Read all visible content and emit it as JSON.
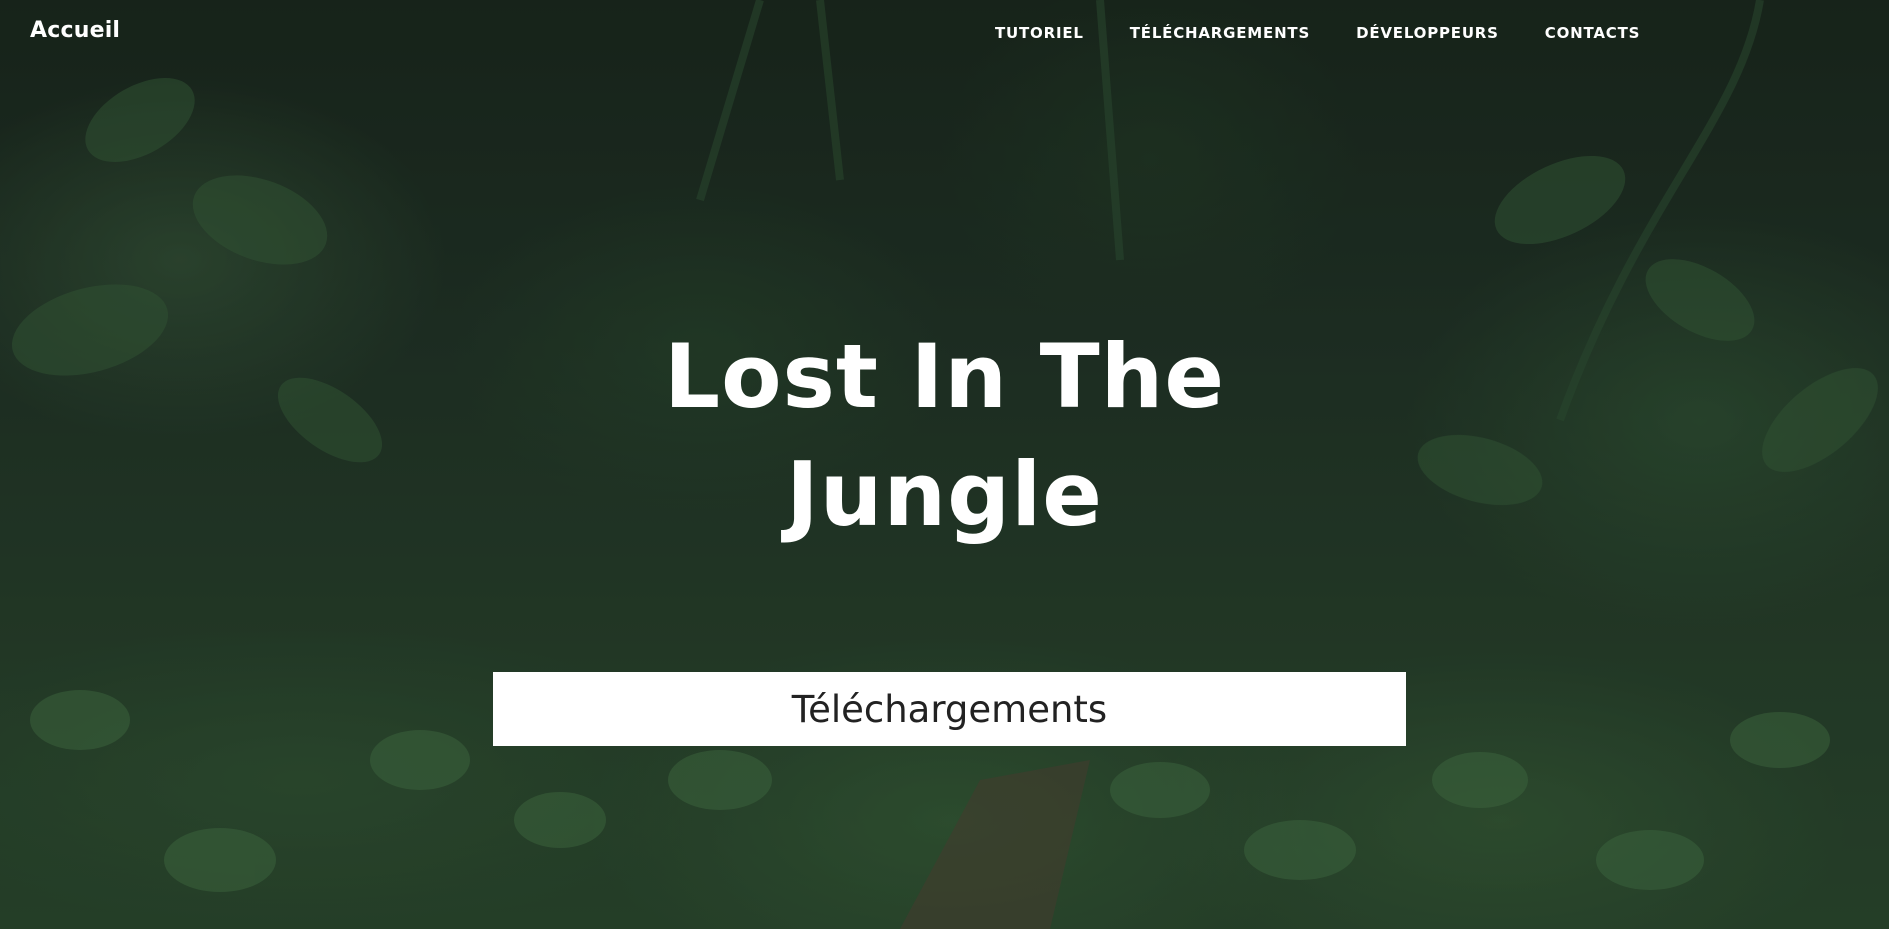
{
  "header": {
    "brand": "Accueil",
    "nav": [
      {
        "label": "TUTORIEL"
      },
      {
        "label": "TÉLÉCHARGEMENTS"
      },
      {
        "label": "DÉVELOPPEURS"
      },
      {
        "label": "CONTACTS"
      }
    ]
  },
  "hero": {
    "title": "Lost In The Jungle",
    "button_label": "Téléchargements",
    "background": "jungle-foliage-photo"
  },
  "colors": {
    "text": "#ffffff",
    "button_bg": "#ffffff",
    "button_text": "#222222"
  }
}
